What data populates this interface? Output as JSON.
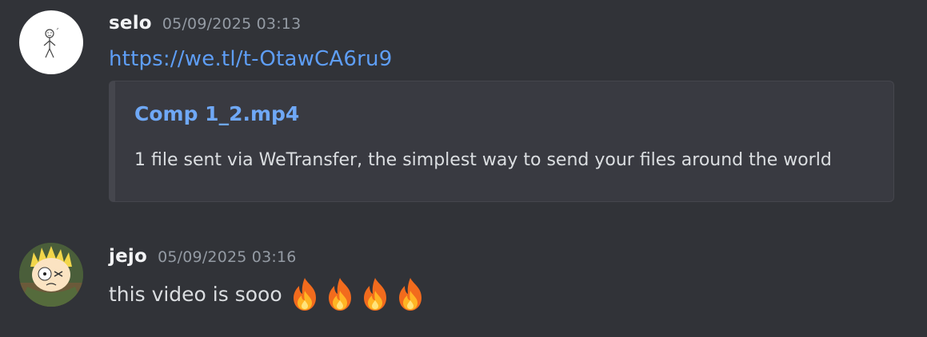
{
  "messages": [
    {
      "username": "selo",
      "timestamp": "05/09/2025 03:13",
      "avatar_icon": "stick-figure-avatar",
      "link": "https://we.tl/t-OtawCA6ru9",
      "embed": {
        "title": "Comp 1_2.mp4",
        "description": "1 file sent via WeTransfer, the simplest way to send your files around the world"
      }
    },
    {
      "username": "jejo",
      "timestamp": "05/09/2025 03:16",
      "avatar_icon": "cartoon-character-avatar",
      "text": "this video is sooo",
      "emoji": [
        "fire",
        "fire",
        "fire",
        "fire"
      ]
    }
  ],
  "colors": {
    "background": "#313338",
    "username": "#f2f3f5",
    "timestamp": "#949ba4",
    "link": "#5e9ef6",
    "embed_background": "#393a41",
    "body_text": "#dbdee1"
  }
}
